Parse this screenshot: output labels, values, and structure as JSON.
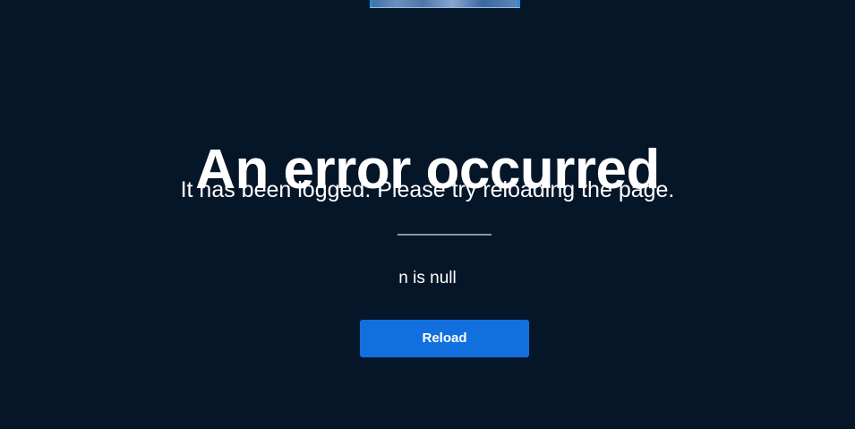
{
  "error_page": {
    "title": "An error occurred",
    "subtitle": "It has been logged. Please try reloading the page.",
    "message": "n is null",
    "reload_label": "Reload"
  },
  "colors": {
    "background": "#061629",
    "button": "#1170dd",
    "divider": "#8a97a8",
    "text": "#ffffff"
  }
}
